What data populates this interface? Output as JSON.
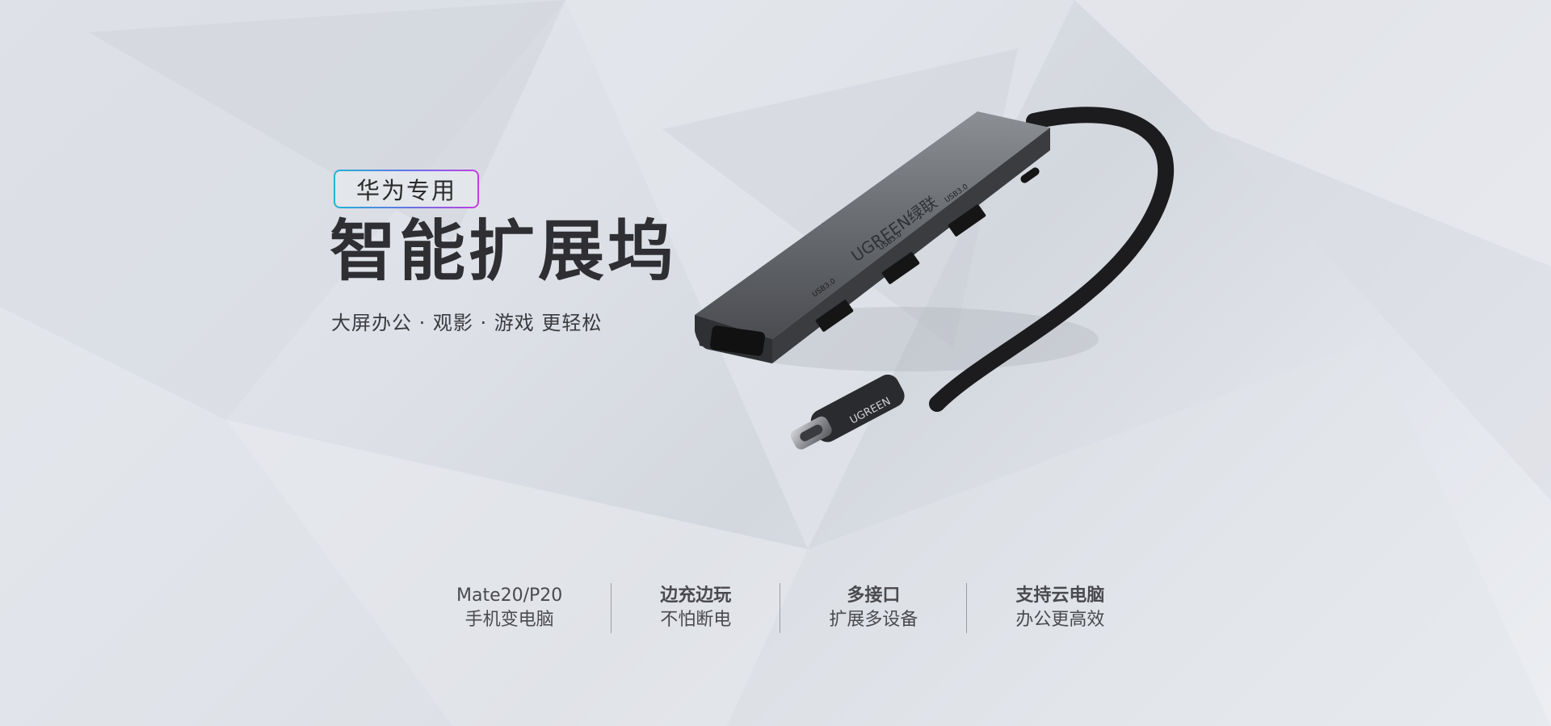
{
  "badge": {
    "label": "华为专用"
  },
  "headline": "智能扩展坞",
  "subline": "大屏办公 · 观影 · 游戏 更轻松",
  "product": {
    "brand_text": "UGREEN绿联",
    "plug_brand": "UGREEN",
    "port_labels": [
      "USB3.0",
      "USB3.0",
      "USB3.0"
    ],
    "colors": {
      "body": "#6b6e73",
      "cable": "#1c1c1e",
      "accent_start": "#1fb4d6",
      "accent_end": "#c33fe0"
    }
  },
  "features": [
    {
      "line1": "Mate20/P20",
      "line2": "手机变电脑"
    },
    {
      "line1": "边充边玩",
      "line2": "不怕断电"
    },
    {
      "line1": "多接口",
      "line2": "扩展多设备"
    },
    {
      "line1": "支持云电脑",
      "line2": "办公更高效"
    }
  ]
}
